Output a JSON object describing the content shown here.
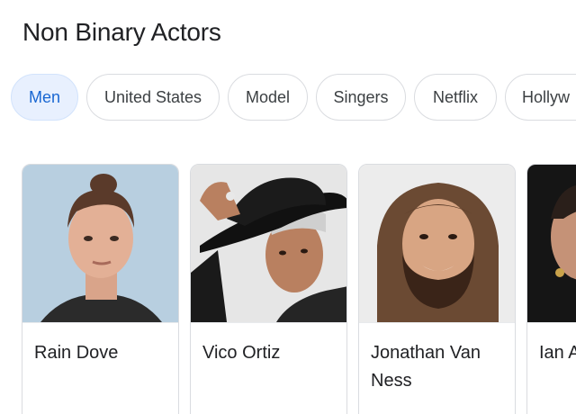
{
  "header": {
    "title": "Non Binary Actors"
  },
  "filters": [
    {
      "label": "Men",
      "selected": true
    },
    {
      "label": "United States",
      "selected": false
    },
    {
      "label": "Model",
      "selected": false
    },
    {
      "label": "Singers",
      "selected": false
    },
    {
      "label": "Netflix",
      "selected": false
    },
    {
      "label": "Hollyw",
      "selected": false
    }
  ],
  "people": [
    {
      "name": "Rain Dove"
    },
    {
      "name": "Vico Ortiz"
    },
    {
      "name": "Jonathan Van Ness"
    },
    {
      "name": "Ian A"
    }
  ],
  "colors": {
    "chip_selected_bg": "#e8f0fe",
    "chip_selected_text": "#1967d2",
    "border": "#dadce0"
  }
}
